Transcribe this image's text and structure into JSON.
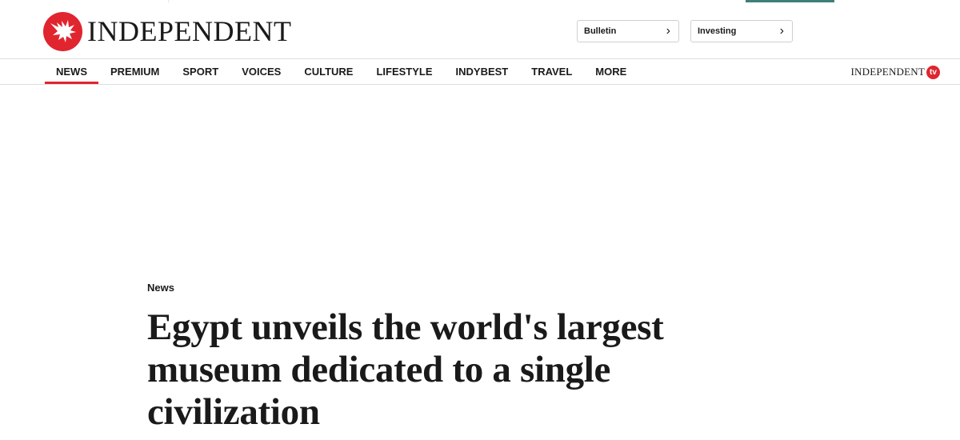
{
  "header": {
    "logo_text": "INDEPENDENT",
    "brand_color": "#e0252f",
    "accent_color": "#3f7f79",
    "buttons": [
      {
        "label": "Bulletin"
      },
      {
        "label": "Investing"
      }
    ]
  },
  "nav": {
    "items": [
      {
        "label": "NEWS",
        "active": true
      },
      {
        "label": "PREMIUM"
      },
      {
        "label": "SPORT"
      },
      {
        "label": "VOICES"
      },
      {
        "label": "CULTURE"
      },
      {
        "label": "LIFESTYLE"
      },
      {
        "label": "INDYBEST"
      },
      {
        "label": "TRAVEL"
      },
      {
        "label": "MORE"
      }
    ],
    "tv_logo_word": "INDEPENDENT",
    "tv_logo_badge": "tv"
  },
  "article": {
    "section": "News",
    "headline": "Egypt unveils the world's largest museum dedicated to a single civilization"
  },
  "icons": {
    "logo": "eagle-icon",
    "chevron": "chevron-right-icon"
  }
}
